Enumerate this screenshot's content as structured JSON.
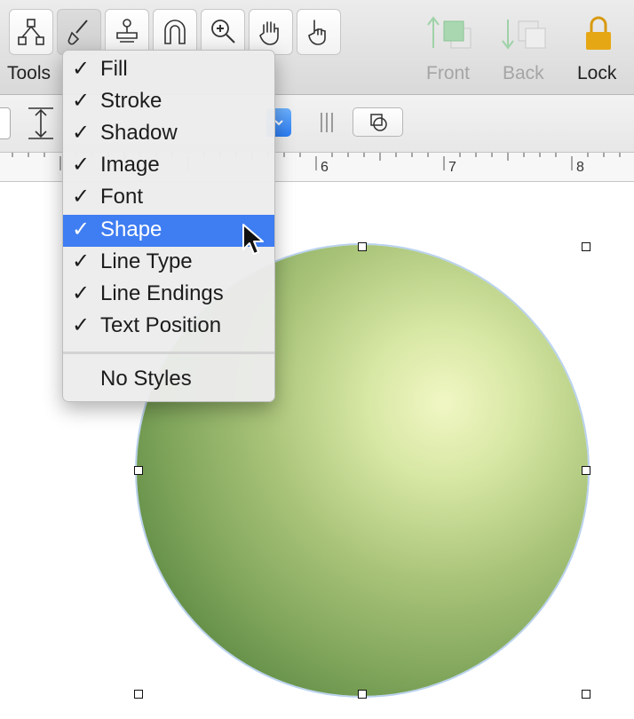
{
  "toolbar": {
    "tools_label": "Tools",
    "front_label": "Front",
    "back_label": "Back",
    "lock_label": "Lock",
    "tool_icons": [
      "diagram-icon",
      "brush-icon",
      "stamp-icon",
      "magnet-icon",
      "zoom-icon",
      "hand-icon",
      "pointing-hand-icon"
    ]
  },
  "ruler": {
    "labels": [
      "6",
      "7",
      "8"
    ]
  },
  "menu": {
    "items": [
      {
        "label": "Fill",
        "checked": true
      },
      {
        "label": "Stroke",
        "checked": true
      },
      {
        "label": "Shadow",
        "checked": true
      },
      {
        "label": "Image",
        "checked": true
      },
      {
        "label": "Font",
        "checked": true
      },
      {
        "label": "Shape",
        "checked": true,
        "highlighted": true
      },
      {
        "label": "Line Type",
        "checked": true
      },
      {
        "label": "Line Endings",
        "checked": true
      },
      {
        "label": "Text Position",
        "checked": true
      }
    ],
    "check_mark": "✓",
    "no_styles_label": "No Styles"
  },
  "colors": {
    "accent": "#3f7df2",
    "lock_gold": "#e6a714",
    "circle_light": "#f1f7c4",
    "circle_dark": "#46712f"
  }
}
